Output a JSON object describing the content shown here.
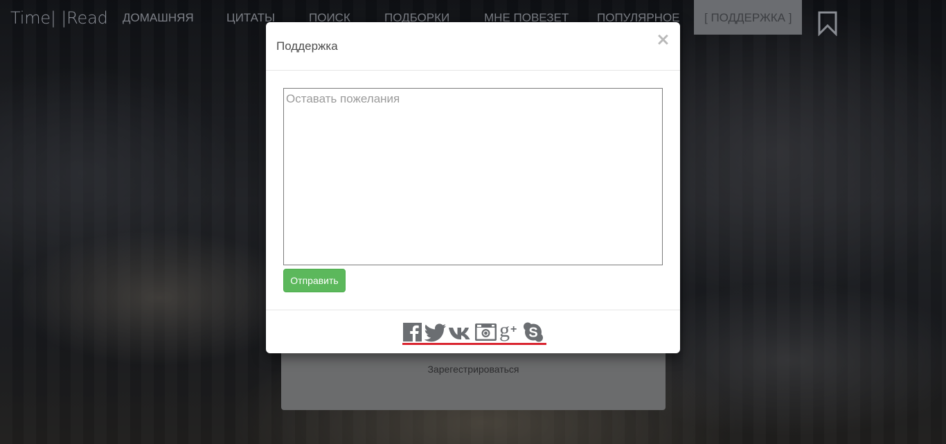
{
  "brand": "Time| |Read",
  "nav": {
    "items": [
      "ДОМАШНЯЯ",
      "ЦИТАТЫ",
      "ПОИСК",
      "ПОДБОРКИ",
      "МНЕ ПОВЕЗЕТ",
      "ПОПУЛЯРНОЕ"
    ],
    "active_item": "[ ПОДДЕРЖКА ]",
    "bookmark_icon": "bookmark-icon"
  },
  "back_card": {
    "register_link": "Зарегестрироваться"
  },
  "modal": {
    "title": "Поддержка",
    "close_label": "×",
    "textarea_placeholder": "Оставать пожелания",
    "textarea_value": "",
    "submit_label": "Отправить",
    "social_icons": [
      "facebook-icon",
      "twitter-icon",
      "vk-icon",
      "instagram-icon",
      "google-plus-icon",
      "skype-icon"
    ],
    "social_underline_color": "#d9232e"
  },
  "colors": {
    "submit_button": "#5cb85c",
    "active_nav_bg": "#6b6d71"
  }
}
